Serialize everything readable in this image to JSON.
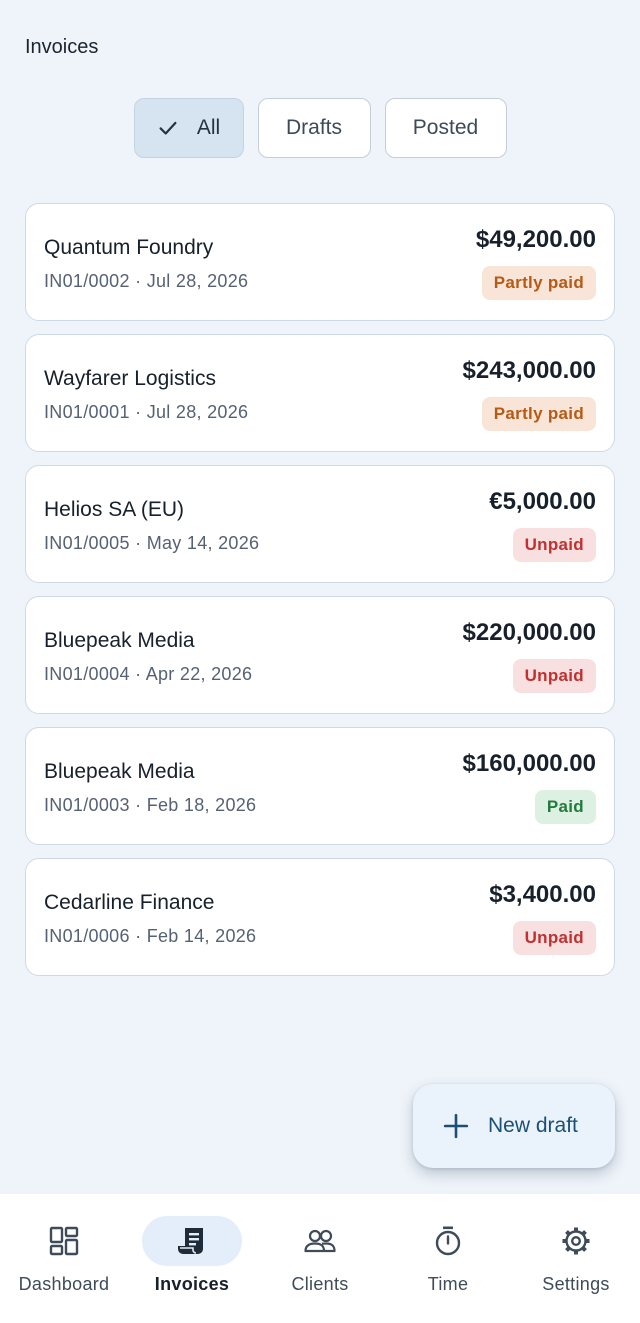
{
  "header": {
    "title": "Invoices"
  },
  "filters": [
    {
      "label": "All",
      "selected": true
    },
    {
      "label": "Drafts",
      "selected": false
    },
    {
      "label": "Posted",
      "selected": false
    }
  ],
  "invoices": [
    {
      "client": "Quantum Foundry",
      "number": "IN01/0002",
      "date": "Jul 28, 2026",
      "amount": "$49,200.00",
      "status": "Partly paid"
    },
    {
      "client": "Wayfarer Logistics",
      "number": "IN01/0001",
      "date": "Jul 28, 2026",
      "amount": "$243,000.00",
      "status": "Partly paid"
    },
    {
      "client": "Helios SA (EU)",
      "number": "IN01/0005",
      "date": "May 14, 2026",
      "amount": "€5,000.00",
      "status": "Unpaid"
    },
    {
      "client": "Bluepeak Media",
      "number": "IN01/0004",
      "date": "Apr 22, 2026",
      "amount": "$220,000.00",
      "status": "Unpaid"
    },
    {
      "client": "Bluepeak Media",
      "number": "IN01/0003",
      "date": "Feb 18, 2026",
      "amount": "$160,000.00",
      "status": "Paid"
    },
    {
      "client": "Cedarline Finance",
      "number": "IN01/0006",
      "date": "Feb 14, 2026",
      "amount": "$3,400.00",
      "status": "Unpaid"
    }
  ],
  "meta_separator": "·",
  "fab": {
    "label": "New draft",
    "icon": "plus-icon"
  },
  "nav": [
    {
      "label": "Dashboard",
      "icon": "dashboard-icon",
      "active": false
    },
    {
      "label": "Invoices",
      "icon": "receipt-icon",
      "active": true
    },
    {
      "label": "Clients",
      "icon": "people-icon",
      "active": false
    },
    {
      "label": "Time",
      "icon": "stopwatch-icon",
      "active": false
    },
    {
      "label": "Settings",
      "icon": "gear-icon",
      "active": false
    }
  ],
  "colors": {
    "background": "#eff4fa",
    "partly_paid": "#b65a15",
    "unpaid": "#c23030",
    "paid": "#237a3e",
    "accent": "#1b4f73"
  }
}
